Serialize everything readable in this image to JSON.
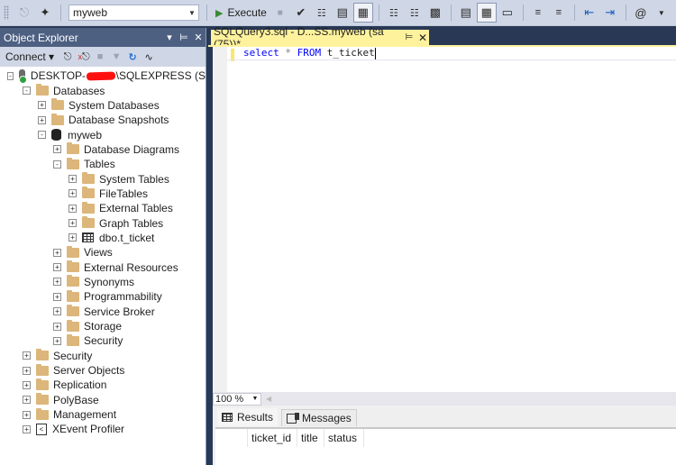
{
  "toolbar": {
    "database": "myweb",
    "execute_label": "Execute",
    "icons": [
      "connect-icon",
      "change-connection-icon",
      "stop-icon",
      "parse-check-icon",
      "display-estimated-plan-icon",
      "query-options-icon",
      "intellisense-icon",
      "include-actual-plan-icon",
      "live-query-stats-icon",
      "client-statistics-icon",
      "results-to-text-icon",
      "results-to-grid-icon",
      "results-to-file-icon",
      "comment-icon",
      "uncomment-icon",
      "decrease-indent-icon",
      "increase-indent-icon",
      "specify-template-values-icon"
    ]
  },
  "object_explorer": {
    "title": "Object Explorer",
    "connect_label": "Connect",
    "server_prefix": "DESKTOP-",
    "server_suffix": "\\SQLEXPRESS (S",
    "tree": [
      {
        "label": "Databases",
        "level": 1,
        "state": "-",
        "icon": "folder"
      },
      {
        "label": "System Databases",
        "level": 2,
        "state": "+",
        "icon": "folder"
      },
      {
        "label": "Database Snapshots",
        "level": 2,
        "state": "+",
        "icon": "folder"
      },
      {
        "label": "myweb",
        "level": 2,
        "state": "-",
        "icon": "database"
      },
      {
        "label": "Database Diagrams",
        "level": 3,
        "state": "+",
        "icon": "folder"
      },
      {
        "label": "Tables",
        "level": 3,
        "state": "-",
        "icon": "folder"
      },
      {
        "label": "System Tables",
        "level": 4,
        "state": "+",
        "icon": "folder"
      },
      {
        "label": "FileTables",
        "level": 4,
        "state": "+",
        "icon": "folder"
      },
      {
        "label": "External Tables",
        "level": 4,
        "state": "+",
        "icon": "folder"
      },
      {
        "label": "Graph Tables",
        "level": 4,
        "state": "+",
        "icon": "folder"
      },
      {
        "label": "dbo.t_ticket",
        "level": 4,
        "state": "+",
        "icon": "table"
      },
      {
        "label": "Views",
        "level": 3,
        "state": "+",
        "icon": "folder"
      },
      {
        "label": "External Resources",
        "level": 3,
        "state": "+",
        "icon": "folder"
      },
      {
        "label": "Synonyms",
        "level": 3,
        "state": "+",
        "icon": "folder"
      },
      {
        "label": "Programmability",
        "level": 3,
        "state": "+",
        "icon": "folder"
      },
      {
        "label": "Service Broker",
        "level": 3,
        "state": "+",
        "icon": "folder"
      },
      {
        "label": "Storage",
        "level": 3,
        "state": "+",
        "icon": "folder"
      },
      {
        "label": "Security",
        "level": 3,
        "state": "+",
        "icon": "folder"
      },
      {
        "label": "Security",
        "level": 1,
        "state": "+",
        "icon": "folder"
      },
      {
        "label": "Server Objects",
        "level": 1,
        "state": "+",
        "icon": "folder"
      },
      {
        "label": "Replication",
        "level": 1,
        "state": "+",
        "icon": "folder"
      },
      {
        "label": "PolyBase",
        "level": 1,
        "state": "+",
        "icon": "folder"
      },
      {
        "label": "Management",
        "level": 1,
        "state": "+",
        "icon": "folder"
      },
      {
        "label": "XEvent Profiler",
        "level": 1,
        "state": "+",
        "icon": "xevent"
      }
    ]
  },
  "editor": {
    "tab_title": "SQLQuery3.sql - D...SS.myweb (sa (75))*",
    "code": {
      "kw1": "select",
      "op": "*",
      "kw2": "FROM",
      "ident": "t_ticket"
    },
    "zoom": "100 %"
  },
  "results": {
    "tabs": [
      "Results",
      "Messages"
    ],
    "columns": [
      "ticket_id",
      "title",
      "status"
    ]
  }
}
